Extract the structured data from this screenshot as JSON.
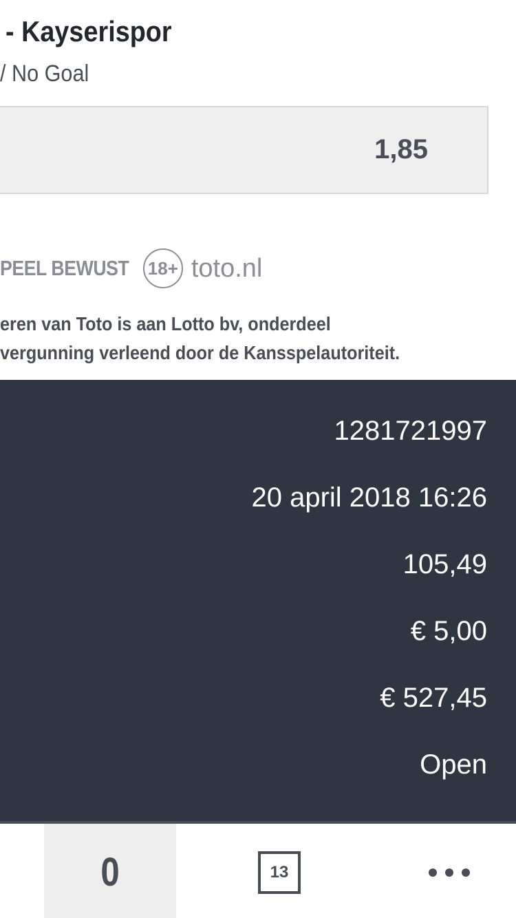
{
  "bet": {
    "match_title": "- Kayserispor",
    "market": "/ No Goal",
    "odds": "1,85"
  },
  "responsible": {
    "text": "PEEL BEWUST",
    "age_badge": "18+",
    "brand": "toto.nl"
  },
  "legal": {
    "line1": "eren van Toto is aan Lotto bv, onderdeel",
    "line2": "vergunning verleend door de Kansspelautoriteit."
  },
  "details": {
    "ticket_number": "1281721997",
    "date": "20 april 2018 16:26",
    "total_odds": "105,49",
    "stake": "€ 5,00",
    "potential_payout": "€ 527,45",
    "status": "Open"
  },
  "tabbar": {
    "bets_count": "0",
    "calendar_day": "13"
  }
}
